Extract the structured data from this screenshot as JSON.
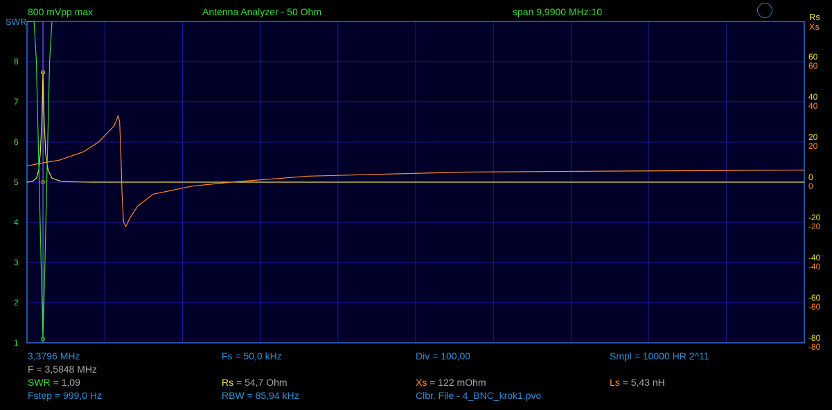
{
  "header": {
    "amplitude": "800 mVpp max",
    "title": "Antenna Analyzer - 50 Ohm",
    "span": "span 9,9900 MHz:10"
  },
  "axes": {
    "left_title": "SWR",
    "right_title_rs": "Rs",
    "right_title_xs": "Xs",
    "left_ticks": [
      "1",
      "2",
      "3",
      "4",
      "5",
      "6",
      "7",
      "8"
    ],
    "right_ticks_rs": [
      "60",
      "40",
      "20",
      "0",
      "-20",
      "-40",
      "-60",
      "-80"
    ],
    "right_ticks_xs": [
      "60",
      "40",
      "20",
      "0",
      "-20",
      "-40",
      "-60",
      "-80"
    ]
  },
  "readout": {
    "freq_start": "3,3796 MHz",
    "fs_label": "Fs",
    "fs_value": " = 50,0 kHz",
    "div_label": "Div",
    "div_value": " = 100,00",
    "smpl_label": "Smpl",
    "smpl_value": " = 10000 HR  2^11",
    "f_label": "F",
    "f_value": " = 3,5848 MHz",
    "swr_label": "SWR",
    "swr_value": " = 1,09",
    "rs_label": "Rs",
    "rs_value": " = 54,7 Ohm",
    "xs_label": "Xs",
    "xs_value": " = 122 mOhm",
    "ls_label": "Ls",
    "ls_value": " = 5,43 nH",
    "fstep_label": "Fstep",
    "fstep_value": " = 999,0 Hz",
    "rbw_label": "RBW",
    "rbw_value": " = 85,94 kHz",
    "clbr_label": "Clbr. File",
    "clbr_value": " - 4_BNC_krok1.pvo"
  },
  "colors": {
    "background": "#000000",
    "plot_bg": "#000028",
    "grid": "#1a1aa0",
    "swr": "#33e033",
    "rs": "#f0e040",
    "xs": "#ff8a28",
    "marker": "#8080ff",
    "text_blue": "#2f8fd6"
  },
  "chart_data": {
    "type": "line",
    "x_start_mhz": 3.3796,
    "span_mhz": 9.99,
    "x_divisions": 10,
    "marker_freq_mhz": 3.5848,
    "swr_axis": [
      1,
      9
    ],
    "rx_axis": [
      -80,
      80
    ],
    "series": [
      {
        "name": "SWR",
        "x": [
          3.3796,
          3.47,
          3.5,
          3.53,
          3.56,
          3.5848,
          3.61,
          3.64,
          3.67,
          3.7
        ],
        "y": [
          9,
          9,
          8,
          5.5,
          3,
          1.09,
          3,
          5.5,
          8,
          9
        ]
      },
      {
        "name": "Rs",
        "x": [
          3.3796,
          3.45,
          3.5,
          3.53,
          3.55,
          3.57,
          3.5848,
          3.6,
          3.62,
          3.65,
          3.7,
          3.8,
          3.9,
          4.0,
          4.2,
          4.5,
          5.0,
          6.0,
          8.0,
          10.0,
          13.37
        ],
        "y": [
          0,
          0.3,
          2,
          6,
          14,
          30,
          54.7,
          30,
          14,
          6,
          2,
          0.6,
          0.2,
          0.1,
          0,
          0,
          0,
          0,
          0,
          0,
          0
        ]
      },
      {
        "name": "Xs",
        "x": [
          3.3796,
          3.5,
          3.8,
          4.1,
          4.3,
          4.5,
          4.55,
          4.57,
          4.5848,
          4.6,
          4.62,
          4.65,
          4.7,
          4.8,
          5.0,
          5.5,
          6.0,
          7.0,
          8.0,
          9.0,
          11.0,
          13.37
        ],
        "y": [
          8,
          9,
          11,
          15,
          20,
          28,
          33,
          30,
          15,
          -5,
          -20,
          -22,
          -18,
          -12,
          -6,
          -2,
          0,
          3,
          4,
          5,
          5.5,
          6
        ]
      }
    ]
  }
}
